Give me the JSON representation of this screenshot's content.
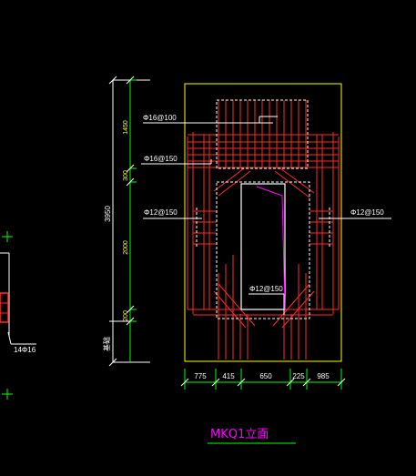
{
  "drawing": {
    "title": "MKQ1立面",
    "colors": {
      "background": "#000000",
      "outline": "#ffff00",
      "rebar": "#ff2a2a",
      "dashed": "#ffffff",
      "dimension": "#00ff00",
      "leader": "#ffffff",
      "title": "#ff00ff",
      "opening_diagonal": "#ff00ff"
    },
    "rebar_callouts": [
      "Φ16@100",
      "Φ16@150",
      "Φ12@150",
      "Φ12@150",
      "Φ12@150"
    ],
    "vertical_dimensions": {
      "total": "3950",
      "segments": [
        "1450",
        "300",
        "2000",
        "200"
      ],
      "base_label": "基础"
    },
    "horizontal_dimensions": [
      "775",
      "415",
      "650",
      "225",
      "985"
    ],
    "side_callout": "14Φ16"
  }
}
